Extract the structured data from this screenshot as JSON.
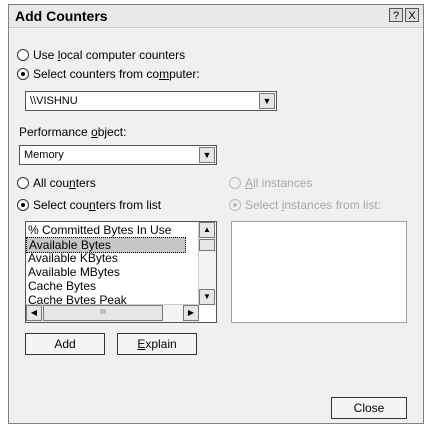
{
  "window": {
    "title": "Add Counters",
    "help_icon": "?",
    "close_icon": "X"
  },
  "source": {
    "local_label_pre": "Use ",
    "local_label_mn": "l",
    "local_label_post": "ocal computer counters",
    "select_label_pre": "Select counters from co",
    "select_label_mn": "m",
    "select_label_post": "puter:",
    "computer_value": "\\\\VISHNU",
    "selected": "computer"
  },
  "performance_object": {
    "label_pre": "Performance ",
    "label_mn": "o",
    "label_post": "bject:",
    "value": "Memory"
  },
  "counters": {
    "all_pre": "All cou",
    "all_mn": "n",
    "all_post": "ters",
    "list_pre": "Select cou",
    "list_mn": "n",
    "list_post": "ters from list",
    "selected": "list",
    "items": [
      "% Committed Bytes In Use",
      "Available Bytes",
      "Available KBytes",
      "Available MBytes",
      "Cache Bytes",
      "Cache Bytes Peak"
    ],
    "selected_item": "Available Bytes",
    "hscroll_grip": "III"
  },
  "instances": {
    "all_mn": "A",
    "all_post": "ll instances",
    "list_pre": "Select ",
    "list_mn": "i",
    "list_post": "nstances from list:",
    "enabled": false
  },
  "buttons": {
    "add": "Add",
    "explain_mn": "E",
    "explain_post": "xplain",
    "close": "Close"
  }
}
